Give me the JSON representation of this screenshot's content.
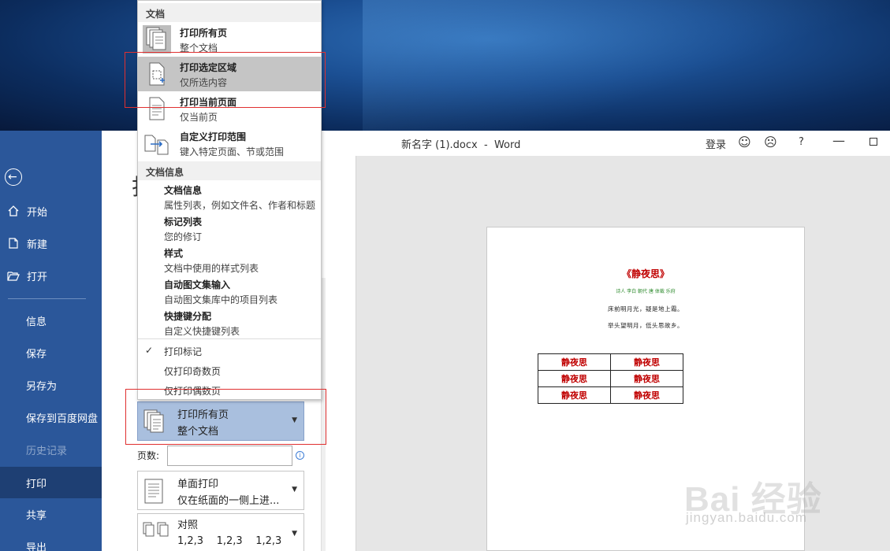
{
  "window": {
    "title": "新名字 (1).docx  -  Word",
    "login_label": "登录",
    "help_label": "?",
    "smile_icon": "☺",
    "frown_icon": "☹"
  },
  "backstage": {
    "page_title": "打",
    "nav": [
      {
        "label": "开始",
        "icon": "home-icon"
      },
      {
        "label": "新建",
        "icon": "new-doc-icon"
      },
      {
        "label": "打开",
        "icon": "folder-open-icon"
      },
      {
        "label": "信息"
      },
      {
        "label": "保存"
      },
      {
        "label": "另存为"
      },
      {
        "label": "保存到百度网盘"
      },
      {
        "label": "历史记录"
      },
      {
        "label": "打印"
      },
      {
        "label": "共享"
      },
      {
        "label": "导出"
      }
    ]
  },
  "print_menu": {
    "section_document": "文档",
    "items": [
      {
        "title": "打印所有页",
        "subtitle": "整个文档"
      },
      {
        "title": "打印选定区域",
        "subtitle": "仅所选内容"
      },
      {
        "title": "打印当前页面",
        "subtitle": "仅当前页"
      },
      {
        "title": "自定义打印范围",
        "subtitle": "键入特定页面、节或范围"
      }
    ],
    "section_info": "文档信息",
    "info_items": [
      {
        "title": "文档信息",
        "subtitle": "属性列表，例如文件名、作者和标题"
      },
      {
        "title": "标记列表",
        "subtitle": "您的修订"
      },
      {
        "title": "样式",
        "subtitle": "文档中使用的样式列表"
      },
      {
        "title": "自动图文集输入",
        "subtitle": "自动图文集库中的项目列表"
      },
      {
        "title": "快捷键分配",
        "subtitle": "自定义快捷键列表"
      }
    ],
    "options": [
      {
        "label": "打印标记",
        "checked": true,
        "check": "✓"
      },
      {
        "label": "仅打印奇数页",
        "checked": false,
        "check": ""
      },
      {
        "label": "仅打印偶数页",
        "checked": false,
        "check": ""
      }
    ]
  },
  "print_settings": {
    "range": {
      "title": "打印所有页",
      "subtitle": "整个文档"
    },
    "pages_label": "页数:",
    "pages_value": "",
    "pages_info": "i",
    "sides": {
      "title": "单面打印",
      "subtitle": "仅在纸面的一侧上进..."
    },
    "collate": {
      "title": "对照",
      "subtitle": "1,2,3    1,2,3    1,2,3"
    }
  },
  "preview": {
    "poem_title": "《静夜思》",
    "poem_meta": "诗人 李白 朝代 唐 体裁 乐府",
    "line1": "床前明月光，疑是地上霜。",
    "line2": "举头望明月，低头思故乡。",
    "table": [
      [
        "静夜思",
        "静夜思"
      ],
      [
        "静夜思",
        "静夜思"
      ],
      [
        "静夜思",
        "静夜思"
      ]
    ]
  },
  "watermark": {
    "brand": "Bai 经验",
    "url": "jingyan.baidu.com"
  },
  "colors": {
    "sidebar": "#2b579a",
    "sidebar_active": "#1e3f73",
    "poem_red": "#c00000",
    "annotation": "#e03030"
  }
}
